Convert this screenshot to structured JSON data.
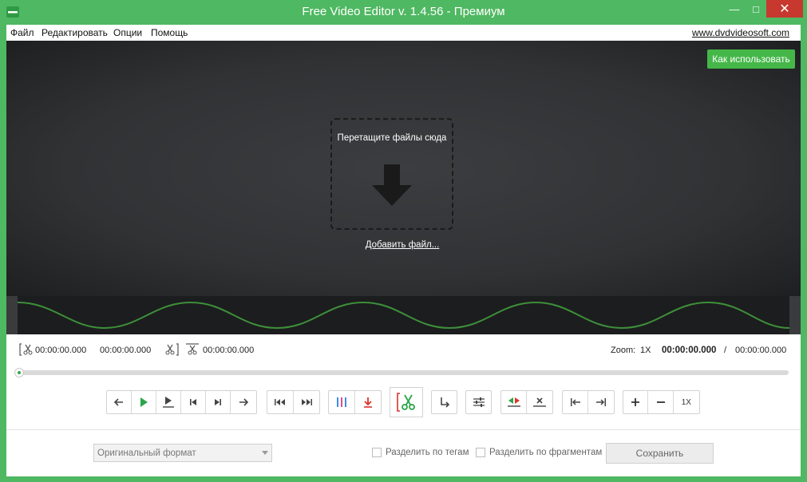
{
  "window": {
    "title": "Free Video Editor v. 1.4.56 - Премиум",
    "minimize_glyph": "—",
    "maximize_glyph": "□",
    "close_glyph": "✕",
    "accent_color": "#4fb862"
  },
  "menu": {
    "items": [
      "Файл",
      "Редактировать",
      "Опции",
      "Помощь"
    ],
    "site_link": "www.dvdvideosoft.com"
  },
  "preview": {
    "help_button": "Как использовать",
    "drop_text": "Перетащите файлы сюда",
    "add_file_link": "Добавить файл...",
    "help_button_color": "#45b749"
  },
  "timecodes": {
    "selection_start": "00:00:00.000",
    "selection_end": "00:00:00.000",
    "cut_length": "00:00:00.000",
    "zoom_label": "Zoom:",
    "zoom_value": "1X",
    "current": "00:00:00.000",
    "separator": "/",
    "total": "00:00:00.000"
  },
  "seek": {
    "position": 0
  },
  "controls": {
    "zoom_reset_label": "1X"
  },
  "output": {
    "format_placeholder": "Оригинальный формат",
    "split_by_tags_label": "Разделить по тегам",
    "split_by_tags_checked": false,
    "split_by_fragments_label": "Разделить по фрагментам",
    "split_by_fragments_checked": false,
    "save_button": "Сохранить"
  }
}
